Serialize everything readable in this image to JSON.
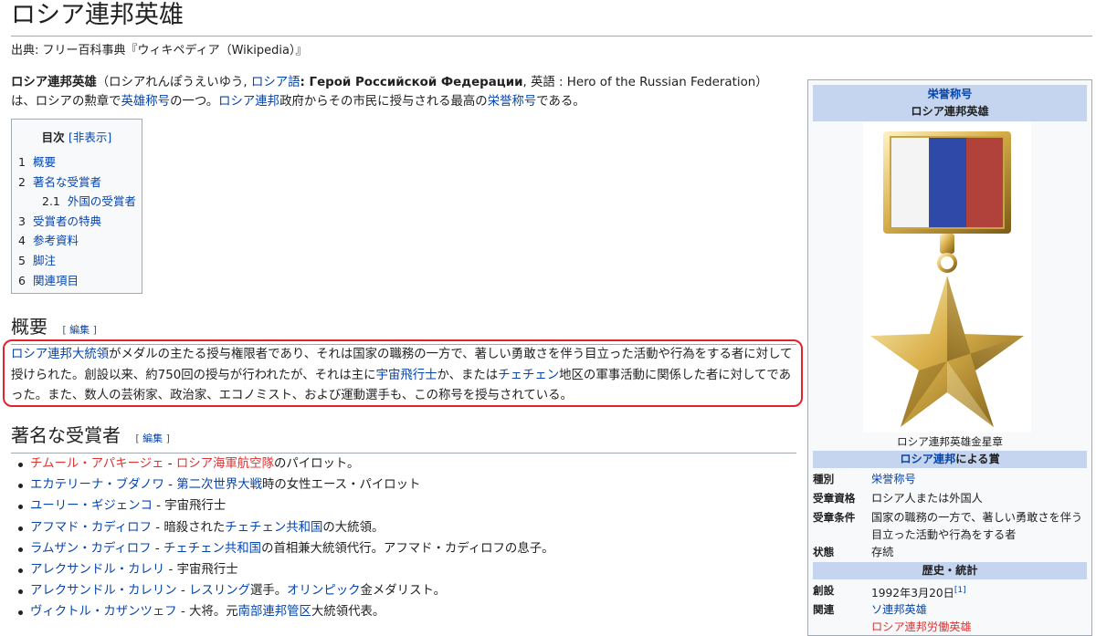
{
  "page": {
    "title": "ロシア連邦英雄",
    "from": "出典: フリー百科事典『ウィキペディア（Wikipedia）』"
  },
  "lead": {
    "bold_title": "ロシア連邦英雄",
    "p1": "（ロシアれんぽうえいゆう, ",
    "link_russian_lang": "ロシア語",
    "p2": ": ",
    "russian_name": "Герой Российской Федерации",
    "p3": ", 英語 : Hero of the Russian Federation）",
    "p4": "は、ロシアの勲章で",
    "link_hero_title": "英雄称号",
    "p5": "の一つ。",
    "link_russia": "ロシア連邦",
    "p6": "政府からその市民に授与される最高の",
    "link_honorary": "栄誉称号",
    "p7": "である。"
  },
  "toc": {
    "title": "目次",
    "hide": "[非表示]",
    "items": [
      {
        "num": "1",
        "label": "概要"
      },
      {
        "num": "2",
        "label": "著名な受賞者"
      },
      {
        "num": "2.1",
        "label": "外国の受賞者"
      },
      {
        "num": "3",
        "label": "受賞者の特典"
      },
      {
        "num": "4",
        "label": "参考資料"
      },
      {
        "num": "5",
        "label": "脚注"
      },
      {
        "num": "6",
        "label": "関連項目"
      }
    ]
  },
  "sections": {
    "overview": {
      "title": "概要",
      "edit": "編集",
      "edit_open": "[ ",
      "edit_close": " ]"
    },
    "recipients": {
      "title": "著名な受賞者",
      "edit": "編集",
      "edit_open": "[ ",
      "edit_close": " ]"
    }
  },
  "overview": {
    "link_president": "ロシア連邦大統領",
    "t1": "がメダルの主たる授与権限者であり、それは国家の職務の一方で、著しい勇敢さを伴う目立った活動や行為をする者に対して授けられた。創設以来、約750回の授与が行われたが、それは主に",
    "link_cosmonaut": "宇宙飛行士",
    "t2": "か、または",
    "link_chechnya": "チェチェン",
    "t3": "地区の軍事活動に関係した者に対してであった。また、数人の芸術家、政治家、エコノミスト、および運動選手も、この称号を授与されている。"
  },
  "recipients": [
    {
      "name": "チムール・アパキージェ",
      "name_red": true,
      "sep": " - ",
      "link": "ロシア海軍航空隊",
      "link_red": true,
      "rest": "のパイロット。"
    },
    {
      "name": "エカテリーナ・ブダノワ",
      "name_red": false,
      "sep": " - ",
      "link": "第二次世界大戦",
      "link_red": false,
      "rest": "時の女性エース・パイロット"
    },
    {
      "name": "ユーリー・ギジェンコ",
      "name_red": false,
      "sep": " - ",
      "link": "",
      "link_red": false,
      "rest": "宇宙飛行士"
    },
    {
      "name": "アフマド・カディロフ",
      "name_red": false,
      "sep": " - 暗殺された",
      "link": "チェチェン共和国",
      "link_red": false,
      "rest": "の大統領。"
    },
    {
      "name": "ラムザン・カディロフ",
      "name_red": false,
      "sep": " - ",
      "link": "チェチェン共和国",
      "link_red": false,
      "rest": "の首相兼大統領代行。アフマド・カディロフの息子。"
    },
    {
      "name": "アレクサンドル・カレリ",
      "name_red": false,
      "sep": " - ",
      "link": "",
      "link_red": false,
      "rest": "宇宙飛行士"
    },
    {
      "name": "アレクサンドル・カレリン",
      "name_red": false,
      "sep": " - ",
      "link": "レスリング",
      "link_red": false,
      "rest": "選手。",
      "link2": "オリンピック",
      "rest2": "金メダリスト。"
    },
    {
      "name": "ヴィクトル・カザンツェフ",
      "name_red": false,
      "sep": " - 大将。元",
      "link": "南部連邦管区",
      "link_red": false,
      "rest": "大統領代表。"
    }
  ],
  "infobox": {
    "category_link": "栄誉称号",
    "name": "ロシア連邦英雄",
    "caption": "ロシア連邦英雄金星章",
    "awarded_by_link": "ロシア連邦",
    "awarded_by_suffix": "による賞",
    "rows": [
      {
        "k": "種別",
        "v": "栄誉称号",
        "link": true
      },
      {
        "k": "受章資格",
        "v": "ロシア人または外国人",
        "link": false
      },
      {
        "k": "受章条件",
        "v": "国家の職務の一方で、著しい勇敢さを伴う目立った活動や行為をする者",
        "link": false
      },
      {
        "k": "状態",
        "v": "存続",
        "link": false
      }
    ],
    "history_title": "歴史・統計",
    "founded_k": "創設",
    "founded_v": "1992年3月20日",
    "founded_ref": "[1]",
    "related_k": "関連",
    "related_v": "ソ連邦英雄",
    "related_v2": "ロシア連邦労働英雄"
  },
  "colors": {
    "link": "#0645ad",
    "redlink": "#d33",
    "highlight": "#e3222c",
    "infobox_header": "#c5d5ef"
  }
}
